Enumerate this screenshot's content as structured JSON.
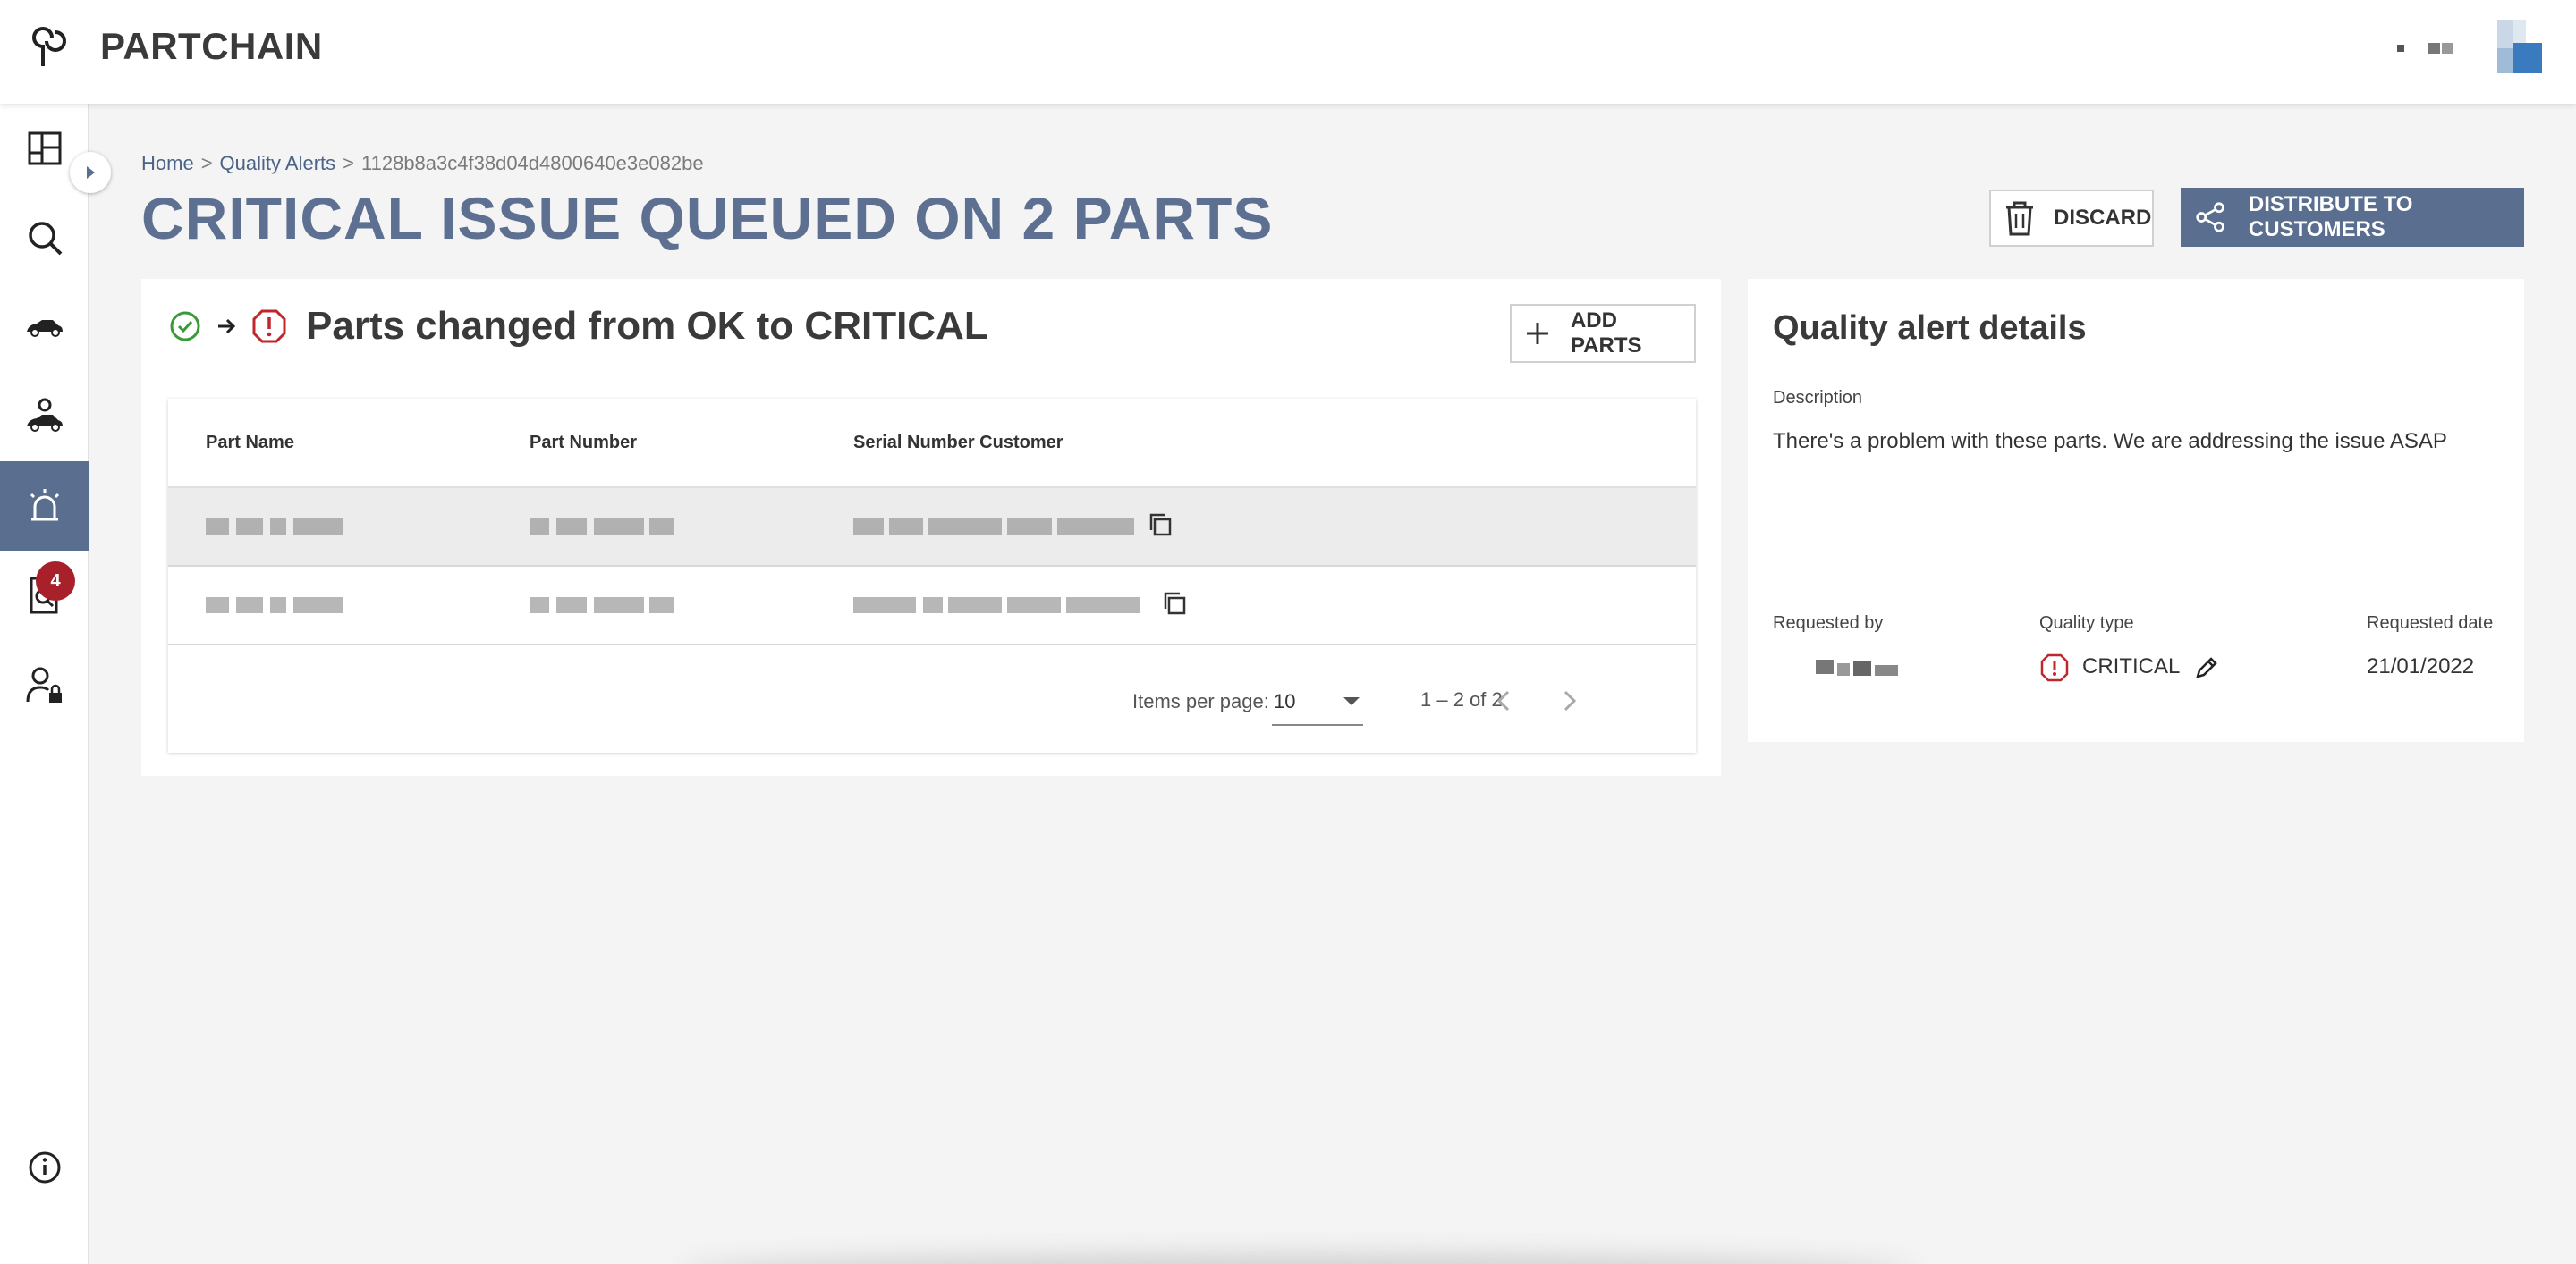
{
  "app": {
    "title": "PARTCHAIN"
  },
  "sidebar": {
    "items": [
      {
        "name": "dashboard",
        "icon": "dashboard-icon"
      },
      {
        "name": "search",
        "icon": "search-icon"
      },
      {
        "name": "car",
        "icon": "car-icon"
      },
      {
        "name": "car-parts",
        "icon": "car-parts-icon"
      },
      {
        "name": "alerts",
        "icon": "alarm-icon",
        "active": true
      },
      {
        "name": "investigations",
        "icon": "file-search-icon",
        "badge": "4"
      },
      {
        "name": "admin",
        "icon": "user-lock-icon"
      },
      {
        "name": "info",
        "icon": "info-icon"
      }
    ]
  },
  "breadcrumb": {
    "home": "Home",
    "sep1": ">",
    "section": "Quality Alerts",
    "sep2": ">",
    "current": "1128b8a3c4f38d04d4800640e3e082be"
  },
  "page": {
    "title": "CRITICAL ISSUE QUEUED ON 2 PARTS"
  },
  "actions": {
    "discard_label": "DISCARD",
    "distribute_label": "DISTRIBUTE TO CUSTOMERS"
  },
  "parts_card": {
    "title": "Parts changed from OK to CRITICAL",
    "from_status_icon": "check-circle-icon",
    "to_status_icon": "critical-hexagon-icon",
    "add_label": "ADD PARTS",
    "columns": [
      "Part Name",
      "Part Number",
      "Serial Number Customer"
    ],
    "rows_count": 2,
    "paginator": {
      "items_per_page_label": "Items per page:",
      "items_per_page_value": "10",
      "range": "1 – 2 of 2"
    }
  },
  "details_card": {
    "title": "Quality alert details",
    "description_label": "Description",
    "description": "There's a problem with these parts. We are addressing the issue ASAP",
    "requested_by_label": "Requested by",
    "quality_type_label": "Quality type",
    "quality_type_value": "CRITICAL",
    "requested_date_label": "Requested date",
    "requested_date_value": "21/01/2022"
  },
  "colors": {
    "primary": "#5a6f8f",
    "critical": "#c0272d",
    "ok": "#3a9a3a",
    "badge": "#a8202a",
    "title": "#5d7091"
  }
}
